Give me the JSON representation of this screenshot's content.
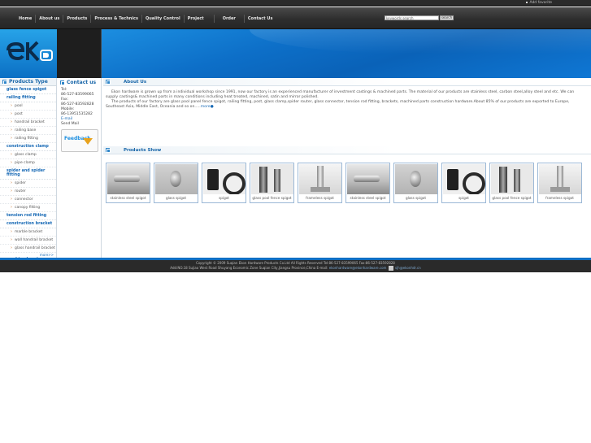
{
  "topbar": {
    "add_favorite": "Add favorite"
  },
  "nav": {
    "items": [
      {
        "label": "Home"
      },
      {
        "label": "About us"
      },
      {
        "label": "Products"
      },
      {
        "label": "Process & Technics"
      },
      {
        "label": "Quality Control"
      },
      {
        "label": "Project"
      },
      {
        "label": "Order"
      },
      {
        "label": "Contact Us"
      }
    ],
    "search_placeholder": "keywords search",
    "search_button": "search"
  },
  "sidebar": {
    "title": "Products Type",
    "categories": [
      {
        "label": "glass fence spigot"
      },
      {
        "label": "railing fitting"
      },
      {
        "label": "pool"
      },
      {
        "label": "post"
      },
      {
        "label": "handrail bracket"
      },
      {
        "label": "railing base"
      },
      {
        "label": "railing fitting"
      },
      {
        "label": "construction clamp"
      },
      {
        "label": "glass clamp"
      },
      {
        "label": "pipe clamp"
      },
      {
        "label": "spider and spider fitting"
      },
      {
        "label": "spider"
      },
      {
        "label": "router"
      },
      {
        "label": "connector"
      },
      {
        "label": "canopy fitting"
      },
      {
        "label": "tension rod fitting"
      },
      {
        "label": "construction bracket"
      },
      {
        "label": "marble bracket"
      },
      {
        "label": "wall handrail bracket"
      },
      {
        "label": "glass handrail bracket"
      },
      {
        "label": "machined parts"
      }
    ],
    "more": "more>>"
  },
  "contact": {
    "title": "Contact us",
    "tel_label": "Tel:",
    "tel": "86-527-83599065",
    "fax_label": "Fax:",
    "fax": "86-527-83592828",
    "mobile_label": "Mobile:",
    "mobile": "86-13951535282",
    "email": "E-mail",
    "send_mail": "Send Mail",
    "feedback": "Feedback"
  },
  "about": {
    "title": "About Us",
    "paragraph1": "Ekon hardware is grown up from a individual workshop since 1991, now our factory is an experienced manufacturer of investment castings & machined parts. The material of our products are stainless steel, carbon steel,alloy steel and etc. We can supply castings& machined parts in many conditions including heat treated, machined, satin and mirror polished.",
    "paragraph2": "The products of our factory are glass pool panel fence spigot, railing fitting, post, glass clamp,spider router, glass connector, tension rod fitting, brackets, machined parts construction hardware.About 85% of our products are exported to Europe, Southeast Asia, Middle East, Oceania and so on.....",
    "more": "more"
  },
  "products_show": {
    "title": "Products Show",
    "items": [
      {
        "caption": "stainless steel spigot",
        "icon": "stainless-spigot-photo"
      },
      {
        "caption": "glass spigot",
        "icon": "glass-spigot-photo"
      },
      {
        "caption": "spigot",
        "icon": "spigot-photo"
      },
      {
        "caption": "glass pool fence spigot",
        "icon": "pool-fence-spigot-photo"
      },
      {
        "caption": "frameless spigot",
        "icon": "frameless-spigot-photo"
      },
      {
        "caption": "stainless steel spigot",
        "icon": "stainless-spigot-photo"
      },
      {
        "caption": "glass spigot",
        "icon": "glass-spigot-photo"
      },
      {
        "caption": "spigot",
        "icon": "spigot-photo"
      },
      {
        "caption": "glass pool fence spigot",
        "icon": "pool-fence-spigot-photo"
      },
      {
        "caption": "frameless spigot",
        "icon": "frameless-spigot-photo"
      }
    ]
  },
  "footer": {
    "line1": "Copyright © 2009 Suqian Ekon Hardware Products Co.Ltd All Rights Reserved   Tel:86-527-83599065   Fax:86-527-83592828",
    "line2": "Add:NO.18 Sujiao West Road Shuyang Economic Zone Suqian City,Jiangsu Province,China   E-mail:",
    "email": "ekonhardware@ekonhardware.com",
    "qq": "sjh@ekonhdr.cn"
  }
}
